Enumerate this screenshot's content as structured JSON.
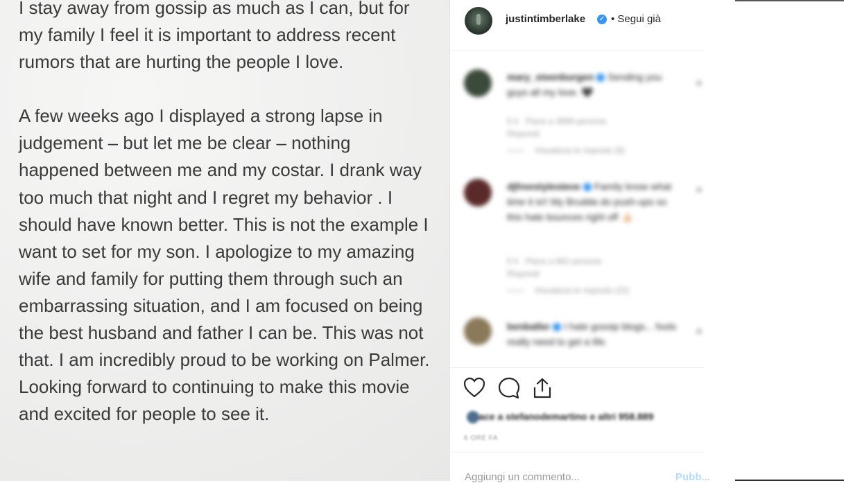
{
  "post_text": {
    "paragraph1": "I stay away from gossip as much as I can, but for my family I feel it is important to address recent rumors that are hurting the people I love.",
    "paragraph2": "A few weeks ago I displayed a strong lapse in judgement – but let me be clear – nothing happened between me and my costar. I drank way too much that night and I regret my behavior . I should have known better. This is not the example I want to set for my son. I apologize to my amazing wife and family for putting them through such an embarrassing situation, and I am focused on being the best husband and father I can be. This was not that. I am incredibly proud to be working on Palmer. Looking forward to continuing to make this movie and excited for people to see it."
  },
  "header": {
    "username": "justintimberlake",
    "follow_status": "• Segui già"
  },
  "comments": [
    {
      "user": "mary_steenburgen",
      "text": "Sending you guys all my love. 🖤",
      "meta_time": "5 h",
      "meta_likes": "Piace a 3999 persone",
      "reply": "Rispondi",
      "view_replies": "Visualizza le risposte (8)",
      "avatar_color": "#3b4a3a"
    },
    {
      "user": "djfreestylesteve",
      "text": "Family know what time it is!! My Brudda do push-ups so this hate bounces right off 👍🏻",
      "meta_time": "5 h",
      "meta_likes": "Piace a 682 persone",
      "reply": "Rispondi",
      "view_replies": "Visualizza le risposte (22)",
      "avatar_color": "#5a2a2a"
    },
    {
      "user": "benballer",
      "text": "I hate gossip blogs... fools really need to get a life.",
      "avatar_color": "#8a7a5a"
    }
  ],
  "actions": {
    "likes_text": "Piace a stefanodemartino e altri 958.889",
    "date": "6 ORE FA"
  },
  "add_comment": {
    "placeholder": "Aggiungi un commento...",
    "publish": "Pubb..."
  }
}
